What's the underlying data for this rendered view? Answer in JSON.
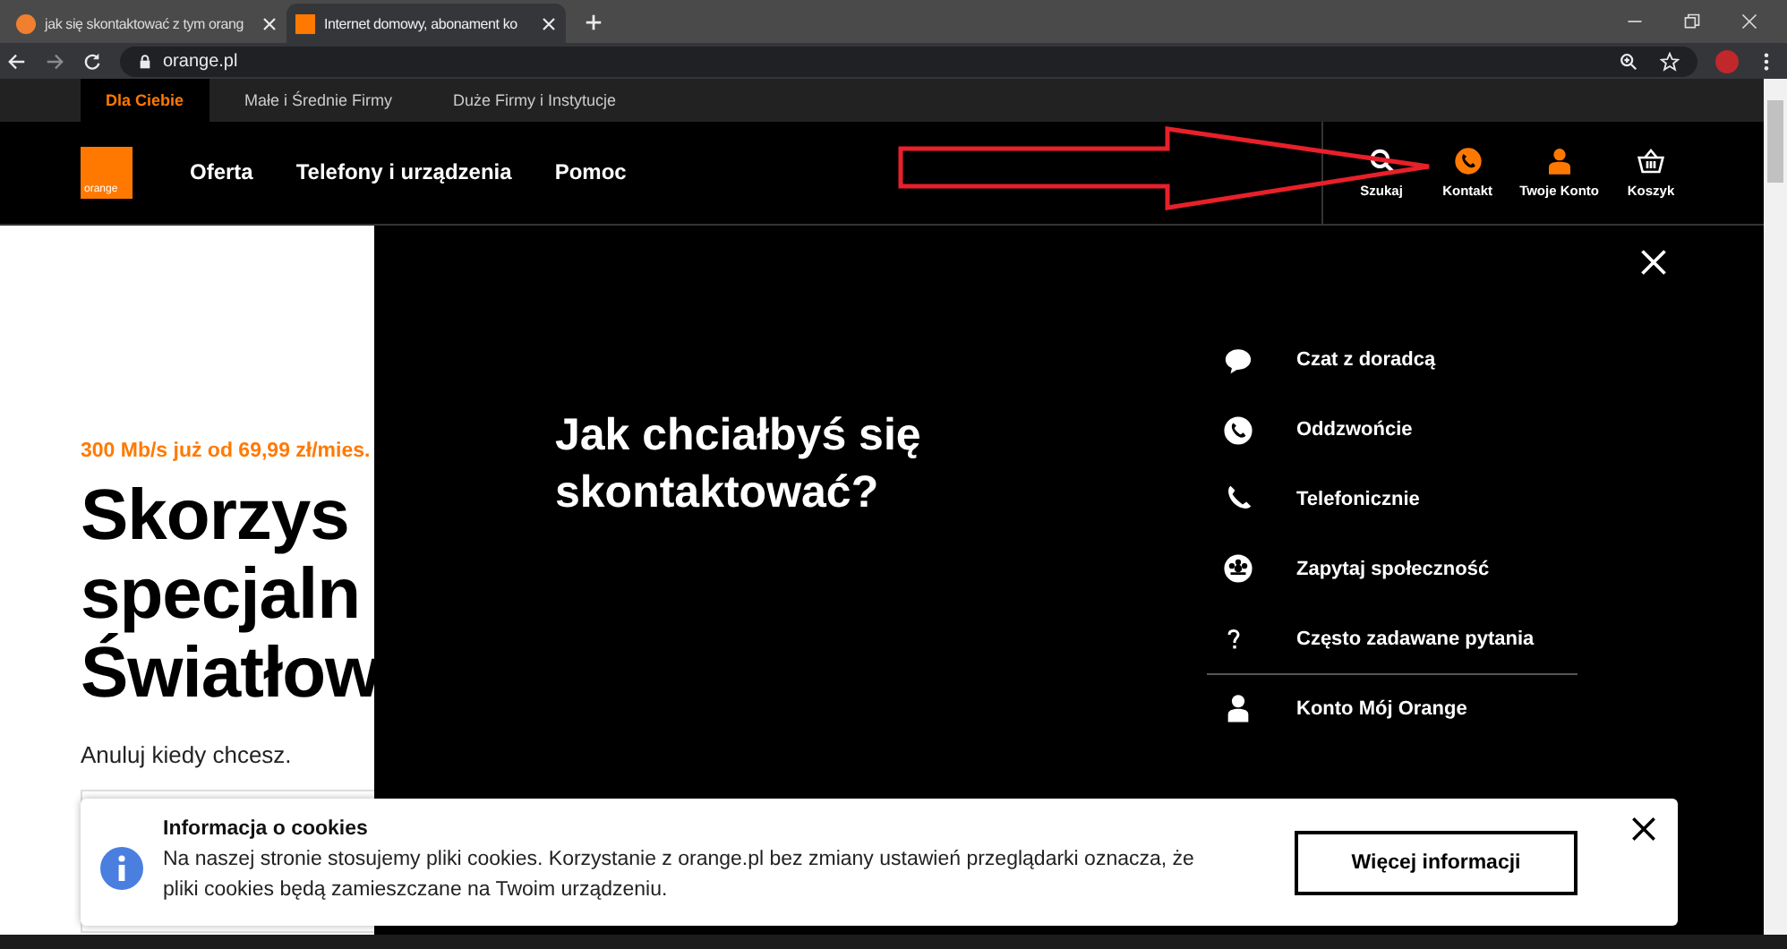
{
  "browser": {
    "tabs": [
      {
        "title": "jak się skontaktować z tym orang",
        "selected": false
      },
      {
        "title": "Internet domowy, abonament ko",
        "selected": true
      }
    ],
    "address": "orange.pl"
  },
  "site": {
    "segments": [
      {
        "label": "Dla Ciebie",
        "selected": true
      },
      {
        "label": "Małe i Średnie Firmy",
        "selected": false
      },
      {
        "label": "Duże Firmy i Instytucje",
        "selected": false
      }
    ],
    "logo": "orange",
    "nav": [
      "Oferta",
      "Telefony i urządzenia",
      "Pomoc"
    ],
    "actions": [
      {
        "label": "Szukaj",
        "kind": "search"
      },
      {
        "label": "Kontakt",
        "kind": "contact"
      },
      {
        "label": "Twoje Konto",
        "kind": "account"
      },
      {
        "label": "Koszyk",
        "kind": "basket"
      }
    ]
  },
  "page": {
    "promo": "300 Mb/s już od 69,99 zł/mies.",
    "headline": [
      "Skorzys",
      "specjaln",
      "Światłow"
    ],
    "subtitle": "Anuluj kiedy chcesz."
  },
  "contact_panel": {
    "title": "Jak chciałbyś się skontaktować?",
    "options": [
      {
        "label": "Czat z doradcą",
        "kind": "chat",
        "separated": false
      },
      {
        "label": "Oddzwońcie",
        "kind": "callback",
        "separated": false
      },
      {
        "label": "Telefonicznie",
        "kind": "phone",
        "separated": false
      },
      {
        "label": "Zapytaj społeczność",
        "kind": "community",
        "separated": false
      },
      {
        "label": "Często zadawane pytania",
        "kind": "faq",
        "separated": false
      },
      {
        "label": "Konto Mój Orange",
        "kind": "account",
        "separated": true
      }
    ]
  },
  "cookie_banner": {
    "title": "Informacja o cookies",
    "text": "Na naszej stronie stosujemy pliki cookies. Korzystanie z orange.pl bez zmiany ustawień przeglądarki oznacza, że pliki cookies będą zamieszczane na Twoim urządzeniu.",
    "button": "Więcej informacji"
  }
}
